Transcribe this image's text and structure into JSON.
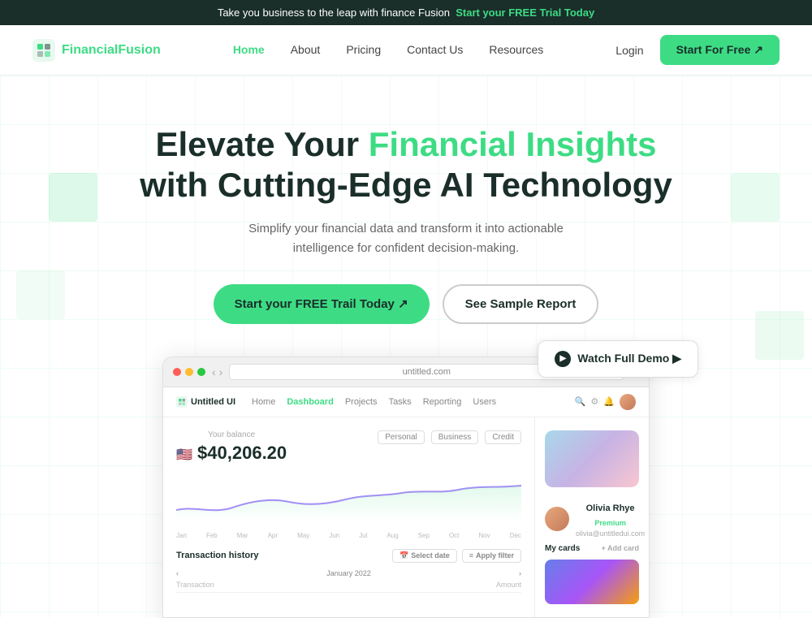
{
  "banner": {
    "text": "Take you business to the leap with finance Fusion",
    "highlight": "Start your FREE Trial Today"
  },
  "navbar": {
    "logo_text": "Financial",
    "logo_text_colored": "Fusion",
    "links": [
      {
        "label": "Home",
        "active": true
      },
      {
        "label": "About",
        "active": false
      },
      {
        "label": "Pricing",
        "active": false
      },
      {
        "label": "Contact Us",
        "active": false
      },
      {
        "label": "Resources",
        "active": false
      }
    ],
    "login_label": "Login",
    "start_free_label": "Start For Free ↗"
  },
  "hero": {
    "title_plain": "Elevate Your",
    "title_colored": "Financial Insights",
    "title_line2": "with Cutting-Edge AI Technology",
    "subtitle": "Simplify your financial data and transform it into actionable intelligence for confident decision-making.",
    "cta_primary": "Start your FREE Trail Today ↗",
    "cta_secondary": "See Sample Report",
    "watch_demo": "Watch Full Demo ▶"
  },
  "browser": {
    "url": "untitled.com",
    "app_logo": "Untitled UI",
    "app_nav": [
      "Home",
      "Dashboard",
      "Projects",
      "Tasks",
      "Reporting",
      "Users"
    ]
  },
  "dashboard": {
    "balance_label": "Your balance",
    "balance_amount": "$40,206.20",
    "balance_tabs": [
      "Personal",
      "Business",
      "Credit"
    ],
    "chart_months": [
      "Jan",
      "Feb",
      "Mar",
      "Apr",
      "May",
      "Jun",
      "Jul",
      "Aug",
      "Sep",
      "Oct",
      "Nov",
      "Dec"
    ],
    "transaction_header": "Transaction history",
    "select_date_label": "Select date",
    "apply_filter_label": "Apply filter",
    "date_nav": "January 2022",
    "col_headers": [
      "Transaction",
      "Amount"
    ],
    "profile_name": "Olivia Rhye",
    "profile_badge": "Premium",
    "profile_email": "olivia@untitledui.com",
    "my_cards": "My cards",
    "add_card": "+ Add card"
  }
}
